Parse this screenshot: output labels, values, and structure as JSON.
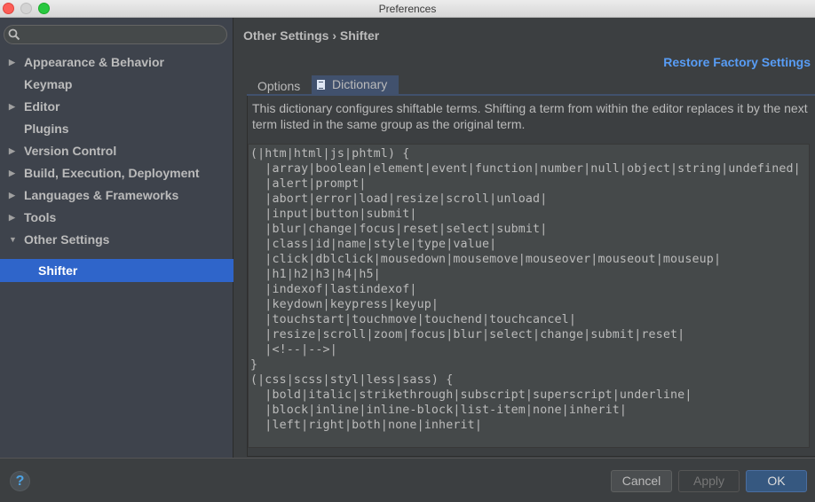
{
  "window": {
    "title": "Preferences"
  },
  "search": {
    "placeholder": "",
    "value": ""
  },
  "sidebar": {
    "items": [
      {
        "label": "Appearance & Behavior",
        "expandable": true,
        "expanded": false
      },
      {
        "label": "Keymap",
        "expandable": false
      },
      {
        "label": "Editor",
        "expandable": true,
        "expanded": false
      },
      {
        "label": "Plugins",
        "expandable": false
      },
      {
        "label": "Version Control",
        "expandable": true,
        "expanded": false
      },
      {
        "label": "Build, Execution, Deployment",
        "expandable": true,
        "expanded": false
      },
      {
        "label": "Languages & Frameworks",
        "expandable": true,
        "expanded": false
      },
      {
        "label": "Tools",
        "expandable": true,
        "expanded": false
      },
      {
        "label": "Other Settings",
        "expandable": true,
        "expanded": true
      }
    ],
    "child": {
      "label": "Shifter",
      "selected": true
    },
    "arrow_collapsed": "▶",
    "arrow_expanded": "▼"
  },
  "header": {
    "breadcrumb": "Other Settings › Shifter",
    "restore_link": "Restore Factory Settings"
  },
  "tabs": [
    {
      "label": "Options",
      "active": false
    },
    {
      "label": "Dictionary",
      "active": true,
      "icon": "document-icon"
    }
  ],
  "dictionary": {
    "description": "This dictionary configures shiftable terms. Shifting a term from within the editor replaces it by the next term listed in the same group as the original term.",
    "content": "(|htm|html|js|phtml) {\n  |array|boolean|element|event|function|number|null|object|string|undefined|\n  |alert|prompt|\n  |abort|error|load|resize|scroll|unload|\n  |input|button|submit|\n  |blur|change|focus|reset|select|submit|\n  |class|id|name|style|type|value|\n  |click|dblclick|mousedown|mousemove|mouseover|mouseout|mouseup|\n  |h1|h2|h3|h4|h5|\n  |indexof|lastindexof|\n  |keydown|keypress|keyup|\n  |touchstart|touchmove|touchend|touchcancel|\n  |resize|scroll|zoom|focus|blur|select|change|submit|reset|\n  |<!--|-->|\n}\n(|css|scss|styl|less|sass) {\n  |bold|italic|strikethrough|subscript|superscript|underline|\n  |block|inline|inline-block|list-item|none|inherit|\n  |left|right|both|none|inherit|"
  },
  "footer": {
    "help_label": "?",
    "cancel_label": "Cancel",
    "apply_label": "Apply",
    "ok_label": "OK"
  },
  "colors": {
    "accent": "#2f65ca",
    "link": "#589df6",
    "ok_button": "#365880"
  }
}
